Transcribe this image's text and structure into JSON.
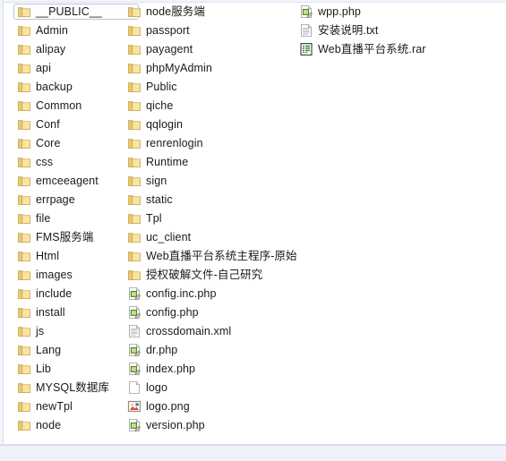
{
  "window": {
    "title": "File Explorer Listing",
    "background_color": "#ffffff",
    "chrome_color": "#eef1fa",
    "selection_border_color": "#b5c4dd"
  },
  "columns": [
    {
      "name": "column-1",
      "items": [
        {
          "label": "__PUBLIC__",
          "icon": "folder-icon",
          "selected": true
        },
        {
          "label": "Admin",
          "icon": "folder-icon",
          "selected": false
        },
        {
          "label": "alipay",
          "icon": "folder-icon",
          "selected": false
        },
        {
          "label": "api",
          "icon": "folder-icon",
          "selected": false
        },
        {
          "label": "backup",
          "icon": "folder-icon",
          "selected": false
        },
        {
          "label": "Common",
          "icon": "folder-icon",
          "selected": false
        },
        {
          "label": "Conf",
          "icon": "folder-icon",
          "selected": false
        },
        {
          "label": "Core",
          "icon": "folder-icon",
          "selected": false
        },
        {
          "label": "css",
          "icon": "folder-icon",
          "selected": false
        },
        {
          "label": "emceeagent",
          "icon": "folder-icon",
          "selected": false
        },
        {
          "label": "errpage",
          "icon": "folder-icon",
          "selected": false
        },
        {
          "label": "file",
          "icon": "folder-icon",
          "selected": false
        },
        {
          "label": "FMS服务端",
          "icon": "folder-icon",
          "selected": false
        },
        {
          "label": "Html",
          "icon": "folder-icon",
          "selected": false
        },
        {
          "label": "images",
          "icon": "folder-icon",
          "selected": false
        },
        {
          "label": "include",
          "icon": "folder-icon",
          "selected": false
        },
        {
          "label": "install",
          "icon": "folder-icon",
          "selected": false
        },
        {
          "label": "js",
          "icon": "folder-icon",
          "selected": false
        },
        {
          "label": "Lang",
          "icon": "folder-icon",
          "selected": false
        },
        {
          "label": "Lib",
          "icon": "folder-icon",
          "selected": false
        },
        {
          "label": "MYSQL数据库",
          "icon": "folder-icon",
          "selected": false
        },
        {
          "label": "newTpl",
          "icon": "folder-icon",
          "selected": false
        },
        {
          "label": "node",
          "icon": "folder-icon",
          "selected": false
        }
      ]
    },
    {
      "name": "column-2",
      "items": [
        {
          "label": "node服务端",
          "icon": "folder-icon",
          "selected": false
        },
        {
          "label": "passport",
          "icon": "folder-icon",
          "selected": false
        },
        {
          "label": "payagent",
          "icon": "folder-icon",
          "selected": false
        },
        {
          "label": "phpMyAdmin",
          "icon": "folder-icon",
          "selected": false
        },
        {
          "label": "Public",
          "icon": "folder-icon",
          "selected": false
        },
        {
          "label": "qiche",
          "icon": "folder-icon",
          "selected": false
        },
        {
          "label": "qqlogin",
          "icon": "folder-icon",
          "selected": false
        },
        {
          "label": "renrenlogin",
          "icon": "folder-icon",
          "selected": false
        },
        {
          "label": "Runtime",
          "icon": "folder-icon",
          "selected": false
        },
        {
          "label": "sign",
          "icon": "folder-icon",
          "selected": false
        },
        {
          "label": "static",
          "icon": "folder-icon",
          "selected": false
        },
        {
          "label": "Tpl",
          "icon": "folder-icon",
          "selected": false
        },
        {
          "label": "uc_client",
          "icon": "folder-icon",
          "selected": false
        },
        {
          "label": "Web直播平台系统主程序-原始",
          "icon": "folder-icon",
          "selected": false
        },
        {
          "label": "授权破解文件-自己研究",
          "icon": "folder-icon",
          "selected": false
        },
        {
          "label": "config.inc.php",
          "icon": "php-file-icon",
          "selected": false
        },
        {
          "label": "config.php",
          "icon": "php-file-icon",
          "selected": false
        },
        {
          "label": "crossdomain.xml",
          "icon": "xml-file-icon",
          "selected": false
        },
        {
          "label": "dr.php",
          "icon": "php-file-icon",
          "selected": false
        },
        {
          "label": "index.php",
          "icon": "php-file-icon",
          "selected": false
        },
        {
          "label": "logo",
          "icon": "blank-file-icon",
          "selected": false
        },
        {
          "label": "logo.png",
          "icon": "image-file-icon",
          "selected": false
        },
        {
          "label": "version.php",
          "icon": "php-file-icon",
          "selected": false
        }
      ]
    },
    {
      "name": "column-3",
      "items": [
        {
          "label": "wpp.php",
          "icon": "php-file-icon",
          "selected": false
        },
        {
          "label": "安装说明.txt",
          "icon": "text-file-icon",
          "selected": false
        },
        {
          "label": "Web直播平台系统.rar",
          "icon": "archive-file-icon",
          "selected": false
        }
      ]
    }
  ]
}
